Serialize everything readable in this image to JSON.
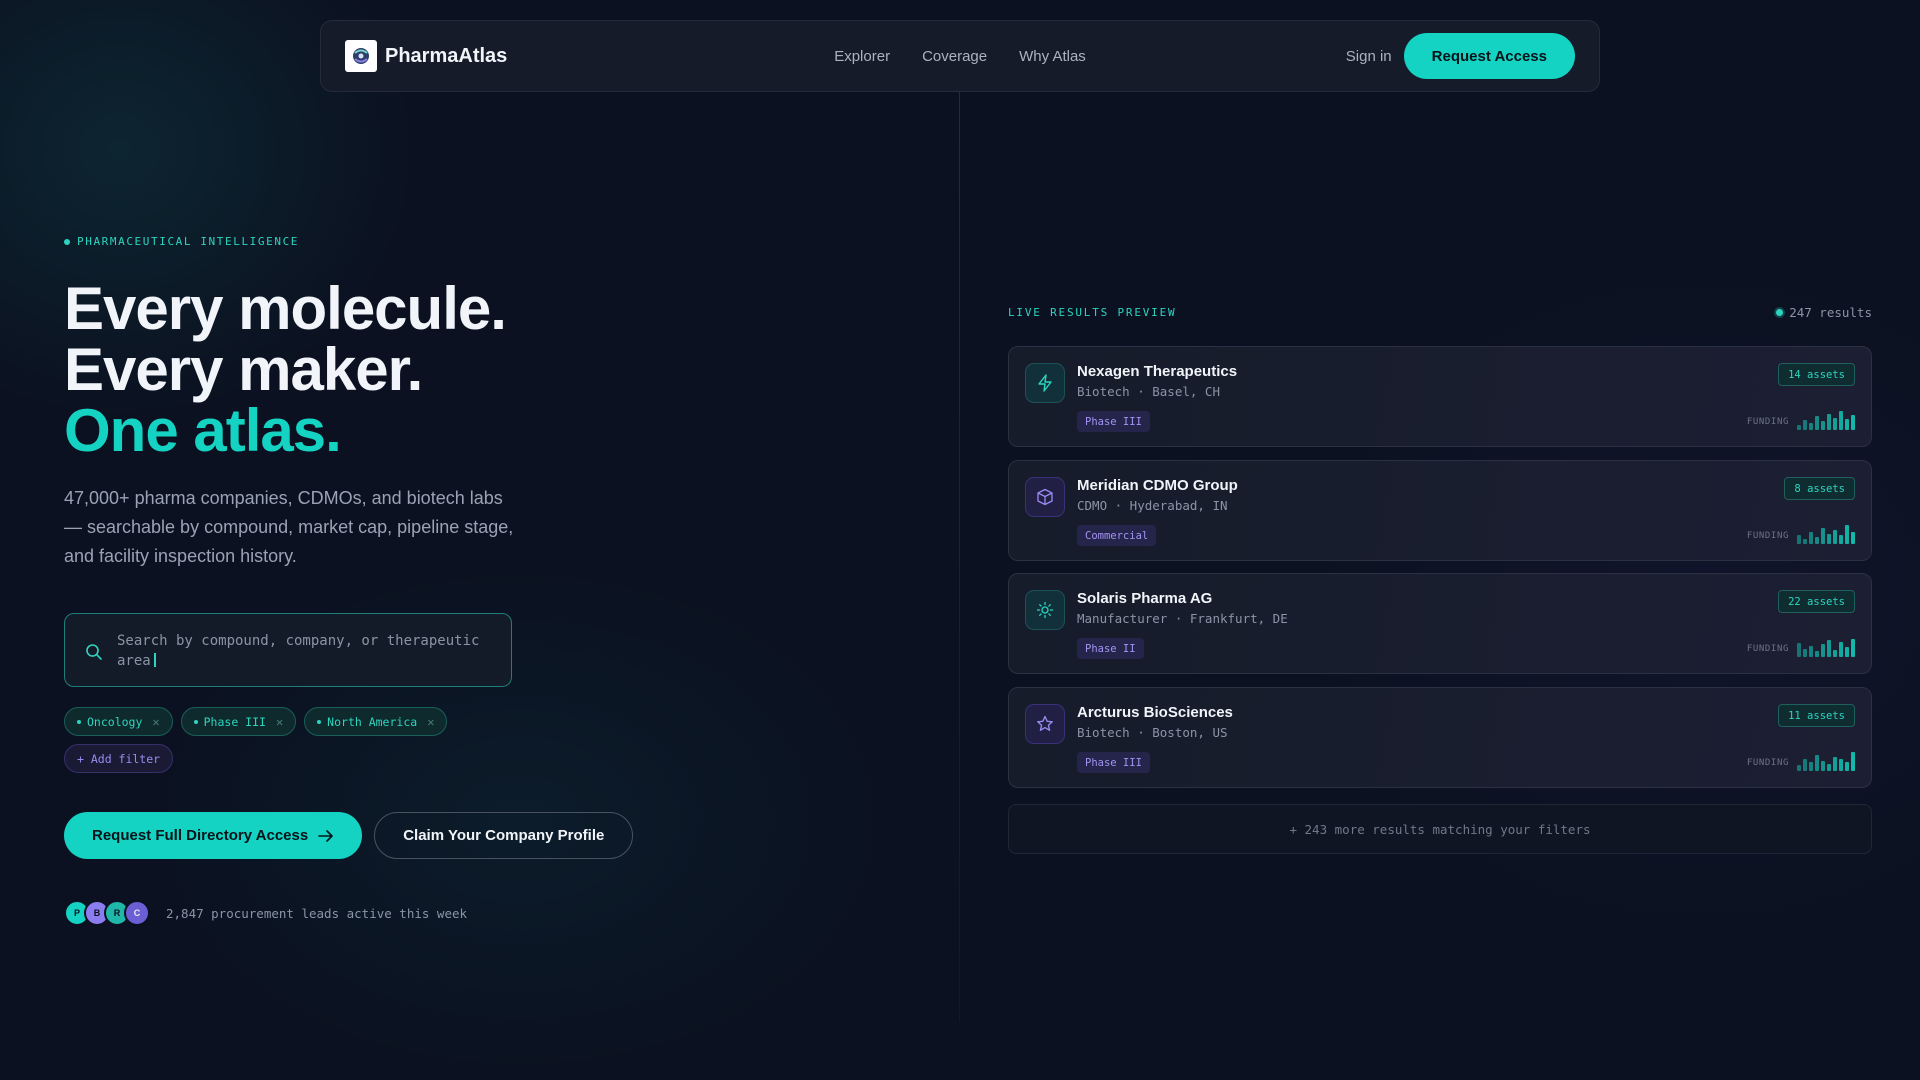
{
  "nav": {
    "brand": "PharmaAtlas",
    "links": [
      "Explorer",
      "Coverage",
      "Why Atlas"
    ],
    "sign_in": "Sign in",
    "request_access": "Request Access"
  },
  "hero": {
    "eyebrow": "PHARMACEUTICAL INTELLIGENCE",
    "headline_1": "Every molecule.",
    "headline_2": "Every maker.",
    "headline_3": "One atlas.",
    "subtext": "47,000+ pharma companies, CDMOs, and biotech labs — searchable by compound, market cap, pipeline stage, and facility inspection history.",
    "search_placeholder": "Search by compound, company, or therapeutic area",
    "chips": [
      "Oncology",
      "Phase III",
      "North America"
    ],
    "add_filter": "+ Add filter",
    "cta_primary": "Request Full Directory Access",
    "cta_secondary": "Claim Your Company Profile",
    "avatars": [
      "P",
      "B",
      "R",
      "C"
    ],
    "social_proof": "2,847 procurement leads active this week"
  },
  "preview": {
    "label": "LIVE RESULTS PREVIEW",
    "results_count": "247 results",
    "funding_label": "FUNDING",
    "more_text": "+ 243 more results matching your filters",
    "cards": [
      {
        "name": "Nexagen Therapeutics",
        "meta": "Biotech · Basel, CH",
        "tag": "Phase III",
        "assets": "14 assets",
        "icon": "bolt-icon",
        "funding": [
          0.25,
          0.5,
          0.35,
          0.7,
          0.45,
          0.8,
          0.6,
          0.95,
          0.55,
          0.75
        ]
      },
      {
        "name": "Meridian CDMO Group",
        "meta": "CDMO · Hyderabad, IN",
        "tag": "Commercial",
        "assets": "8 assets",
        "icon": "cube-icon",
        "funding": [
          0.45,
          0.25,
          0.6,
          0.35,
          0.8,
          0.5,
          0.7,
          0.45,
          0.95,
          0.6
        ]
      },
      {
        "name": "Solaris Pharma AG",
        "meta": "Manufacturer · Frankfurt, DE",
        "tag": "Phase II",
        "assets": "22 assets",
        "icon": "sun-icon",
        "funding": [
          0.7,
          0.4,
          0.55,
          0.3,
          0.65,
          0.85,
          0.35,
          0.75,
          0.5,
          0.9
        ]
      },
      {
        "name": "Arcturus BioSciences",
        "meta": "Biotech · Boston, US",
        "tag": "Phase III",
        "assets": "11 assets",
        "icon": "star-icon",
        "funding": [
          0.3,
          0.6,
          0.45,
          0.8,
          0.5,
          0.35,
          0.7,
          0.6,
          0.45,
          0.95
        ]
      }
    ]
  },
  "colors": {
    "accent": "#14d3c3",
    "background": "#0b1120",
    "purple_tag": "#a394f2"
  }
}
